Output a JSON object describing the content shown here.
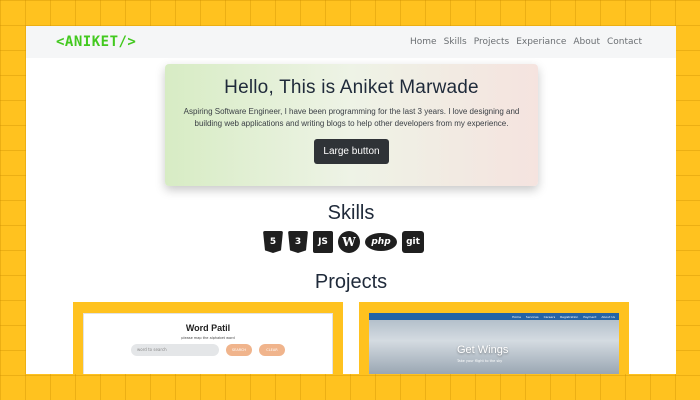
{
  "brand": "<ANIKET/>",
  "nav": [
    "Home",
    "Skills",
    "Projects",
    "Experiance",
    "About",
    "Contact"
  ],
  "hero": {
    "title": "Hello, This is Aniket Marwade",
    "text": "Aspiring Software Engineer, I have been programming for the last 3 years. I love designing and building web applications and writing blogs to help other developers from my experience.",
    "button": "Large button"
  },
  "skills": {
    "title": "Skills",
    "icons": [
      {
        "name": "html5-icon",
        "glyph": "5"
      },
      {
        "name": "css3-icon",
        "glyph": "3"
      },
      {
        "name": "javascript-icon",
        "glyph": "JS"
      },
      {
        "name": "wordpress-icon",
        "glyph": "W"
      },
      {
        "name": "php-icon",
        "glyph": "php"
      },
      {
        "name": "git-icon",
        "glyph": "git"
      }
    ]
  },
  "projects": {
    "title": "Projects",
    "word_patil": {
      "title": "Word Patil",
      "subtitle": "please map the alphabet word",
      "placeholder": "word to search",
      "btn1": "SEARCH",
      "btn2": "CLEAR"
    },
    "get_wings": {
      "title": "Get Wings",
      "subtitle": "Take your flight to the sky",
      "nav": [
        "Home",
        "Services",
        "Careers",
        "Registration",
        "Payment",
        "About Us"
      ]
    }
  },
  "colors": {
    "background": "#FFC21F",
    "brand": "#43c91f",
    "button": "#2f3337"
  }
}
